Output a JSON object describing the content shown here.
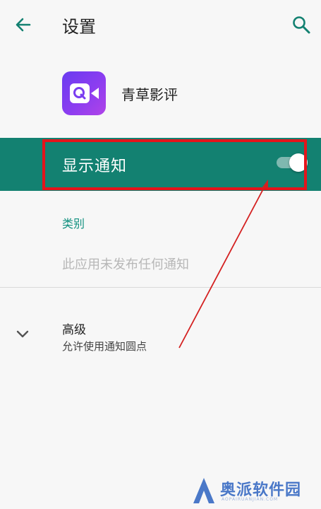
{
  "header": {
    "title": "设置",
    "back_icon": "arrow-back-icon",
    "search_icon": "search-icon"
  },
  "app": {
    "name": "青草影评",
    "icon": "video-camera-q-icon"
  },
  "notifications": {
    "label": "显示通知",
    "enabled": true
  },
  "category": {
    "label": "类别",
    "empty_message": "此应用未发布任何通知"
  },
  "advanced": {
    "title": "高级",
    "subtitle": "允许使用通知圆点",
    "icon": "chevron-down-icon"
  },
  "watermark": {
    "text": "奥派软件园",
    "sub": "AOPAIRUANJIAN.COM"
  },
  "colors": {
    "accent": "#138171",
    "highlight": "#e4141b",
    "category_text": "#11907f"
  }
}
